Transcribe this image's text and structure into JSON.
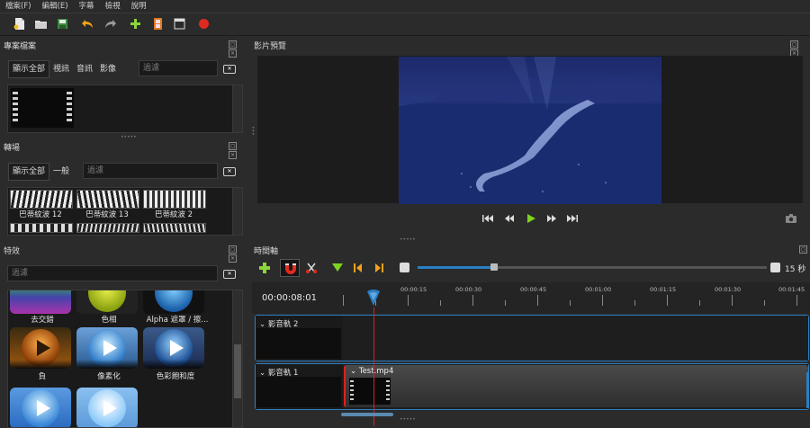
{
  "menu": [
    "檔案(F)",
    "編輯(E)",
    "字幕",
    "檢視",
    "說明"
  ],
  "toolbar_icons": [
    "new-file-icon",
    "open-folder-icon",
    "save-icon",
    "undo-icon",
    "redo-icon",
    "add-icon",
    "film-strip-icon",
    "window-icon",
    "record-icon"
  ],
  "project_files": {
    "title": "專案檔案",
    "tabs": [
      "顯示全部",
      "視訊",
      "音訊",
      "影像"
    ],
    "filter_placeholder": "過濾"
  },
  "transitions": {
    "title": "轉場",
    "tabs": [
      "顯示全部",
      "一般"
    ],
    "filter_placeholder": "過濾",
    "items": [
      "巴蒂紋波 12",
      "巴蒂紋波 13",
      "巴蒂紋波 2"
    ]
  },
  "effects": {
    "title": "特效",
    "filter_placeholder": "過濾",
    "row1": [
      "去交錯",
      "色相",
      "Alpha 遮罩 / 擦..."
    ],
    "row2": [
      "負",
      "像素化",
      "色彩飽和度"
    ]
  },
  "preview": {
    "title": "影片預覽"
  },
  "timeline": {
    "title": "時間軸",
    "zoom_label": "15 秒",
    "zoom_value": 0.22,
    "current_time": "00:00:08:01",
    "ticks": [
      "00:00:15",
      "00:00:30",
      "00:00:45",
      "00:01:00",
      "00:01:15",
      "00:01:30",
      "00:01:45"
    ],
    "tracks": [
      {
        "name": "影音軌 2"
      },
      {
        "name": "影音軌 1",
        "clip": "Test.mp4"
      }
    ]
  },
  "colors": {
    "accent": "#2a7fc4",
    "playhead": "#e02020",
    "play_green": "#7ed321",
    "record_red": "#e02a1f",
    "toolbar_add_green": "#8bd63a"
  }
}
